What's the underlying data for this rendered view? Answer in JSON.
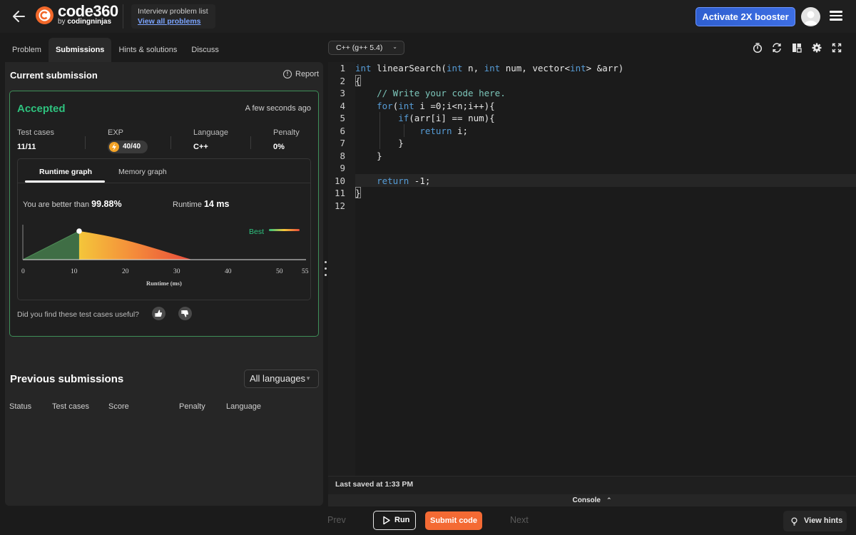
{
  "topbar": {
    "logo_text": "code360",
    "logo_by": "by",
    "logo_brand": "codingninjas",
    "problem_list_label": "Interview problem list",
    "view_all_label": "View all problems",
    "booster_label": "Activate 2X booster"
  },
  "tabs": [
    "Problem",
    "Submissions",
    "Hints & solutions",
    "Discuss"
  ],
  "submission": {
    "title": "Current submission",
    "report_label": "Report",
    "status": "Accepted",
    "time_ago": "A few seconds ago",
    "stats": {
      "test_cases_label": "Test cases",
      "test_cases_value": "11/11",
      "exp_label": "EXP",
      "exp_value": "40/40",
      "language_label": "Language",
      "language_value": "C++",
      "penalty_label": "Penalty",
      "penalty_value": "0%"
    },
    "graph": {
      "tab_runtime": "Runtime graph",
      "tab_memory": "Memory graph",
      "better_label": "You are better than",
      "better_value": "99.88%",
      "runtime_label": "Runtime",
      "runtime_value": "14 ms",
      "legend_best": "Best",
      "xlabel": "Runtime (ms)",
      "ticks": [
        "0",
        "10",
        "20",
        "30",
        "40",
        "50",
        "55"
      ]
    },
    "useful_question": "Did you find these test cases useful?"
  },
  "previous": {
    "title": "Previous submissions",
    "filter_value": "All languages",
    "columns": [
      "Status",
      "Test cases",
      "Score",
      "Penalty",
      "Language"
    ]
  },
  "editor": {
    "language": "C++ (g++ 5.4)",
    "line_numbers": [
      "1",
      "2",
      "3",
      "4",
      "5",
      "6",
      "7",
      "8",
      "9",
      "10",
      "11",
      "12"
    ],
    "lines": [
      "int linearSearch(int n, int num, vector<int> &arr)",
      "{",
      "    // Write your code here.",
      "    for(int i =0;i<n;i++){",
      "        if(arr[i] == num){",
      "            return i;",
      "        }",
      "    }",
      "",
      "    return -1;",
      "}",
      ""
    ],
    "saved_label": "Last saved at 1:33 PM",
    "console_label": "Console"
  },
  "footer": {
    "prev_label": "Prev",
    "run_label": "Run",
    "submit_label": "Submit code",
    "next_label": "Next",
    "hints_label": "View hints"
  },
  "colors": {
    "accent_orange": "#f46a34",
    "accepted_green": "#2ec27e",
    "booster_blue": "#3d6ee4",
    "keyword_blue": "#569cd6"
  },
  "icons": [
    "back-arrow-icon",
    "code360-logo-icon",
    "avatar-icon",
    "hamburger-menu-icon",
    "info-icon",
    "lightning-coin-icon",
    "thumbs-up-icon",
    "thumbs-down-icon",
    "timer-icon",
    "refresh-icon",
    "layout-icon",
    "settings-gear-icon",
    "fullscreen-icon",
    "play-icon",
    "lightbulb-icon"
  ]
}
